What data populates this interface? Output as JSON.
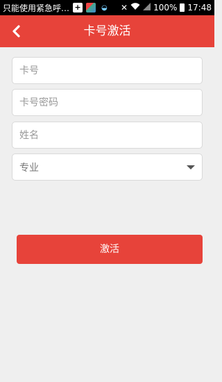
{
  "status_bar": {
    "notification": "只能使用紧急呼…",
    "battery": "100%",
    "time": "17:48"
  },
  "header": {
    "title": "卡号激活",
    "back_icon": "chevron-left-icon"
  },
  "form": {
    "card_number_placeholder": "卡号",
    "card_password_placeholder": "卡号密码",
    "name_placeholder": "姓名",
    "major_label": "专业"
  },
  "submit_label": "激活",
  "colors": {
    "accent": "#e7433a",
    "background": "#efefef"
  }
}
